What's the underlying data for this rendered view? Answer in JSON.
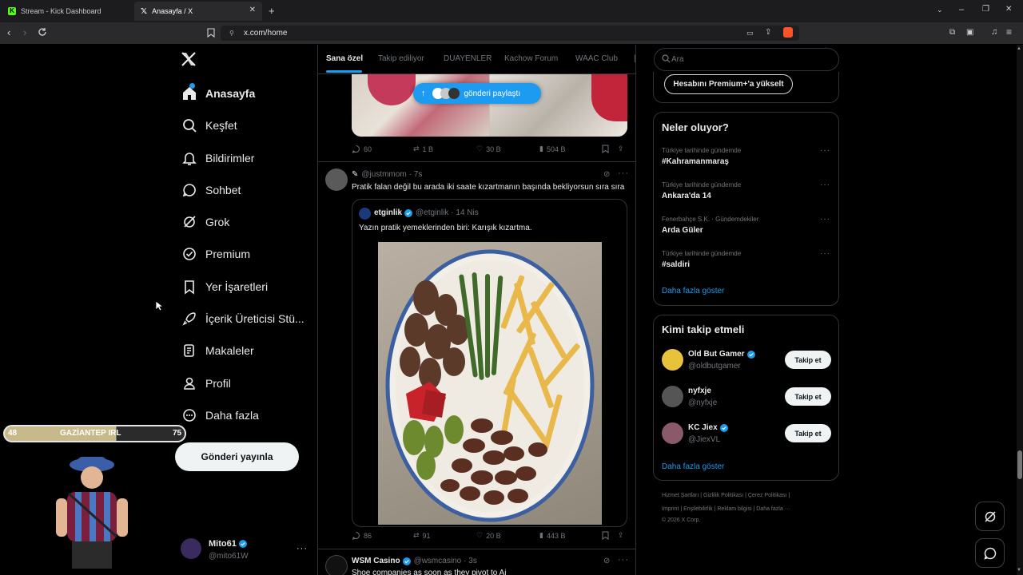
{
  "browser": {
    "tabs": [
      {
        "title": "Stream - Kick Dashboard",
        "active": false
      },
      {
        "title": "Anasayfa / X",
        "active": true
      }
    ],
    "url": "x.com/home"
  },
  "nav": {
    "items": [
      {
        "label": "Anasayfa",
        "icon": "home-icon",
        "active": true
      },
      {
        "label": "Keşfet",
        "icon": "search-icon"
      },
      {
        "label": "Bildirimler",
        "icon": "bell-icon"
      },
      {
        "label": "Sohbet",
        "icon": "chat-icon"
      },
      {
        "label": "Grok",
        "icon": "grok-icon"
      },
      {
        "label": "Premium",
        "icon": "verified-icon"
      },
      {
        "label": "Yer İşaretleri",
        "icon": "bookmark-icon"
      },
      {
        "label": "İçerik Üreticisi Stü...",
        "icon": "rocket-icon"
      },
      {
        "label": "Makaleler",
        "icon": "article-icon"
      },
      {
        "label": "Profil",
        "icon": "person-icon"
      },
      {
        "label": "Daha fazla",
        "icon": "more-circle-icon"
      }
    ],
    "post_button": "Gönderi yayınla",
    "account": {
      "name": "Mito61",
      "handle": "@mito61W"
    }
  },
  "overlay": {
    "left_num": "48",
    "label": "GAZİANTEP IRL",
    "right_num": "75"
  },
  "feed": {
    "tabs": [
      "Sana özel",
      "Takip ediliyor",
      "DUAYENLER",
      "Kachow Forum",
      "WAAC Club"
    ],
    "new_posts_pill": "gönderi paylaştı",
    "post1_stats": {
      "replies": "60",
      "reposts": "1 B",
      "likes": "30 B",
      "views": "504 B"
    },
    "post2": {
      "handle": "@justmmom",
      "time": "· 7s",
      "text": "Pratik falan değil bu arada iki saate kızartmanın başında bekliyorsun sıra sıra",
      "quote": {
        "name": "etginlik",
        "handle": "@etginlik",
        "date": "· 14 Nis",
        "text": "Yazın pratik yemeklerinden biri: Karışık kızartma."
      },
      "stats": {
        "replies": "86",
        "reposts": "91",
        "likes": "20 B",
        "views": "443 B"
      }
    },
    "post3": {
      "name": "WSM Casino",
      "handle": "@wsmcasino",
      "time": "· 3s",
      "text": "Shoe companies as soon as they pivot to Ai"
    }
  },
  "right": {
    "search_placeholder": "Ara",
    "premium_button": "Hesabını Premium+'a yükselt",
    "trends_title": "Neler oluyor?",
    "trends": [
      {
        "meta": "Türkiye tarihinde gündemde",
        "title": "#Kahramanmaraş"
      },
      {
        "meta": "Türkiye tarihinde gündemde",
        "title": "Ankara'da 14"
      },
      {
        "meta": "Fenerbahçe S.K. · Gündemdekiler",
        "title": "Arda Güler"
      },
      {
        "meta": "Türkiye tarihinde gündemde",
        "title": "#saldiri"
      }
    ],
    "show_more": "Daha fazla göster",
    "who_title": "Kimi takip etmeli",
    "who": [
      {
        "name": "Old But Gamer",
        "handle": "@oldbutgamer",
        "verified": true
      },
      {
        "name": "nyfxje",
        "handle": "@nyfxje",
        "verified": false
      },
      {
        "name": "KC Jiex",
        "handle": "@JiexVL",
        "verified": true
      }
    ],
    "follow_label": "Takip et",
    "footer1": "Hizmet Şartları  |  Gizlilik Politikası  |  Çerez Politikası  |",
    "footer2": "Imprint  |  Erişilebilirlik  |  Reklam bilgisi  |  Daha fazla ···",
    "footer3": "© 2026 X Corp."
  },
  "colors": {
    "accent": "#1d9bf0",
    "border": "#2f3336",
    "muted": "#71767b"
  }
}
